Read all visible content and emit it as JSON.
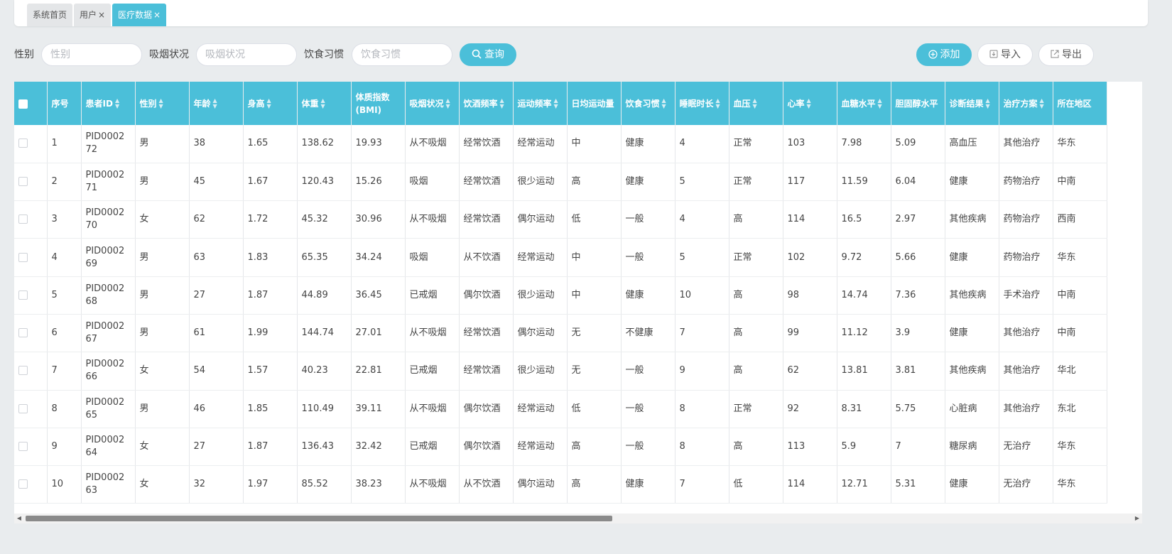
{
  "tabs": [
    {
      "label": "系统首页",
      "closable": false,
      "active": false
    },
    {
      "label": "用户",
      "closable": true,
      "active": false
    },
    {
      "label": "医疗数据",
      "closable": true,
      "active": true
    }
  ],
  "close_glyph": "×",
  "search": {
    "gender_label": "性别",
    "gender_placeholder": "性别",
    "smoking_label": "吸烟状况",
    "smoking_placeholder": "吸烟状况",
    "diet_label": "饮食习惯",
    "diet_placeholder": "饮食习惯",
    "query_button": "查询"
  },
  "actions": {
    "add": "添加",
    "import": "导入",
    "export": "导出"
  },
  "colors": {
    "accent": "#4bbfd9"
  },
  "table": {
    "columns": [
      {
        "label": "",
        "sortable": false,
        "width": 46
      },
      {
        "label": "序号",
        "sortable": false,
        "width": 48
      },
      {
        "label": "患者ID",
        "sortable": true,
        "width": 76
      },
      {
        "label": "性别",
        "sortable": true,
        "width": 76
      },
      {
        "label": "年龄",
        "sortable": true,
        "width": 76
      },
      {
        "label": "身高",
        "sortable": true,
        "width": 76
      },
      {
        "label": "体重",
        "sortable": true,
        "width": 76
      },
      {
        "label": "体质指数(BMI)",
        "sortable": false,
        "width": 76
      },
      {
        "label": "吸烟状况",
        "sortable": true,
        "width": 76
      },
      {
        "label": "饮酒频率",
        "sortable": true,
        "width": 76
      },
      {
        "label": "运动频率",
        "sortable": true,
        "width": 76
      },
      {
        "label": "日均运动量",
        "sortable": false,
        "width": 76
      },
      {
        "label": "饮食习惯",
        "sortable": true,
        "width": 76
      },
      {
        "label": "睡眠时长",
        "sortable": true,
        "width": 76
      },
      {
        "label": "血压",
        "sortable": true,
        "width": 76
      },
      {
        "label": "心率",
        "sortable": true,
        "width": 76
      },
      {
        "label": "血糖水平",
        "sortable": true,
        "width": 76
      },
      {
        "label": "胆固醇水平",
        "sortable": false,
        "width": 76
      },
      {
        "label": "诊断结果",
        "sortable": true,
        "width": 76
      },
      {
        "label": "治疗方案",
        "sortable": true,
        "width": 76
      },
      {
        "label": "所在地区",
        "sortable": false,
        "width": 76
      }
    ],
    "rows": [
      [
        "1",
        "PID000272",
        "男",
        "38",
        "1.65",
        "138.62",
        "19.93",
        "从不吸烟",
        "经常饮酒",
        "经常运动",
        "中",
        "健康",
        "4",
        "正常",
        "103",
        "7.98",
        "5.09",
        "高血压",
        "其他治疗",
        "华东"
      ],
      [
        "2",
        "PID000271",
        "男",
        "45",
        "1.67",
        "120.43",
        "15.26",
        "吸烟",
        "经常饮酒",
        "很少运动",
        "高",
        "健康",
        "5",
        "正常",
        "117",
        "11.59",
        "6.04",
        "健康",
        "药物治疗",
        "中南"
      ],
      [
        "3",
        "PID000270",
        "女",
        "62",
        "1.72",
        "45.32",
        "30.96",
        "从不吸烟",
        "经常饮酒",
        "偶尔运动",
        "低",
        "一般",
        "4",
        "高",
        "114",
        "16.5",
        "2.97",
        "其他疾病",
        "药物治疗",
        "西南"
      ],
      [
        "4",
        "PID000269",
        "男",
        "63",
        "1.83",
        "65.35",
        "34.24",
        "吸烟",
        "从不饮酒",
        "经常运动",
        "中",
        "一般",
        "5",
        "正常",
        "102",
        "9.72",
        "5.66",
        "健康",
        "药物治疗",
        "华东"
      ],
      [
        "5",
        "PID000268",
        "男",
        "27",
        "1.87",
        "44.89",
        "36.45",
        "已戒烟",
        "偶尔饮酒",
        "很少运动",
        "中",
        "健康",
        "10",
        "高",
        "98",
        "14.74",
        "7.36",
        "其他疾病",
        "手术治疗",
        "中南"
      ],
      [
        "6",
        "PID000267",
        "男",
        "61",
        "1.99",
        "144.74",
        "27.01",
        "从不吸烟",
        "经常饮酒",
        "偶尔运动",
        "无",
        "不健康",
        "7",
        "高",
        "99",
        "11.12",
        "3.9",
        "健康",
        "其他治疗",
        "中南"
      ],
      [
        "7",
        "PID000266",
        "女",
        "54",
        "1.57",
        "40.23",
        "22.81",
        "已戒烟",
        "经常饮酒",
        "很少运动",
        "无",
        "一般",
        "9",
        "高",
        "62",
        "13.81",
        "3.81",
        "其他疾病",
        "其他治疗",
        "华北"
      ],
      [
        "8",
        "PID000265",
        "男",
        "46",
        "1.85",
        "110.49",
        "39.11",
        "从不吸烟",
        "偶尔饮酒",
        "经常运动",
        "低",
        "一般",
        "8",
        "正常",
        "92",
        "8.31",
        "5.75",
        "心脏病",
        "其他治疗",
        "东北"
      ],
      [
        "9",
        "PID000264",
        "女",
        "27",
        "1.87",
        "136.43",
        "32.42",
        "已戒烟",
        "偶尔饮酒",
        "经常运动",
        "高",
        "一般",
        "8",
        "高",
        "113",
        "5.9",
        "7",
        "糖尿病",
        "无治疗",
        "华东"
      ],
      [
        "10",
        "PID000263",
        "女",
        "32",
        "1.97",
        "85.52",
        "38.23",
        "从不吸烟",
        "从不饮酒",
        "偶尔运动",
        "高",
        "健康",
        "7",
        "低",
        "114",
        "12.71",
        "5.31",
        "健康",
        "无治疗",
        "华东"
      ]
    ]
  }
}
